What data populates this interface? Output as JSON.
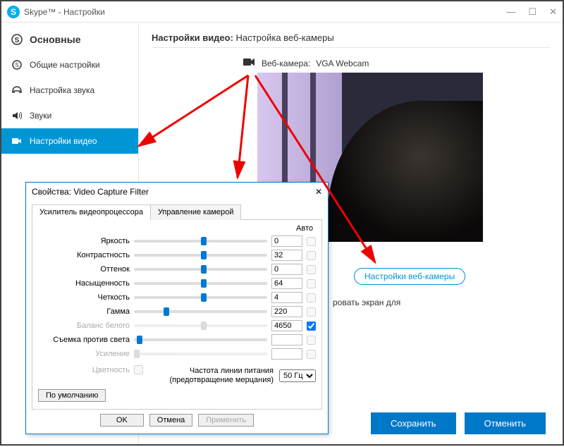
{
  "titlebar": {
    "title": "Skype™ - Настройки"
  },
  "sidebar": {
    "heading": "Основные",
    "items": [
      {
        "label": "Общие настройки"
      },
      {
        "label": "Настройка звука"
      },
      {
        "label": "Звуки"
      },
      {
        "label": "Настройки видео"
      }
    ]
  },
  "content": {
    "section_prefix": "Настройки видео: ",
    "section_title": "Настройка веб-камеры",
    "webcam_label": "Веб-камера:",
    "webcam_name": "VGA Webcam",
    "webcam_settings_btn": "Настройки веб-камеры",
    "truncated": "ровать экран для"
  },
  "buttons": {
    "save": "Сохранить",
    "cancel": "Отменить"
  },
  "dialog": {
    "title": "Свойства: Video Capture Filter",
    "tabs": {
      "amp": "Усилитель видеопроцессора",
      "cam": "Управление камерой"
    },
    "auto_header": "Авто",
    "sliders": [
      {
        "label": "Яркость",
        "value": "0",
        "pos": 50,
        "auto": false,
        "auto_enabled": false,
        "enabled": true
      },
      {
        "label": "Контрастность",
        "value": "32",
        "pos": 50,
        "auto": false,
        "auto_enabled": false,
        "enabled": true
      },
      {
        "label": "Оттенок",
        "value": "0",
        "pos": 50,
        "auto": false,
        "auto_enabled": false,
        "enabled": true
      },
      {
        "label": "Насыщенность",
        "value": "64",
        "pos": 50,
        "auto": false,
        "auto_enabled": false,
        "enabled": true
      },
      {
        "label": "Четкость",
        "value": "4",
        "pos": 50,
        "auto": false,
        "auto_enabled": false,
        "enabled": true
      },
      {
        "label": "Гамма",
        "value": "220",
        "pos": 22,
        "auto": false,
        "auto_enabled": false,
        "enabled": true
      },
      {
        "label": "Баланс белого",
        "value": "4650",
        "pos": 50,
        "auto": true,
        "auto_enabled": true,
        "enabled": false
      },
      {
        "label": "Съемка против света",
        "value": "",
        "pos": 2,
        "auto": false,
        "auto_enabled": false,
        "enabled": true
      },
      {
        "label": "Усиление",
        "value": "",
        "pos": 0,
        "auto": false,
        "auto_enabled": false,
        "enabled": false
      }
    ],
    "colorfulness_label": "Цветность",
    "freq_label_l1": "Частота линии питания",
    "freq_label_l2": "(предотвращение мерцания)",
    "freq_value": "50 Гц",
    "defaults": "По умолчанию",
    "ok": "OK",
    "cancel": "Отмена",
    "apply": "Применить"
  }
}
